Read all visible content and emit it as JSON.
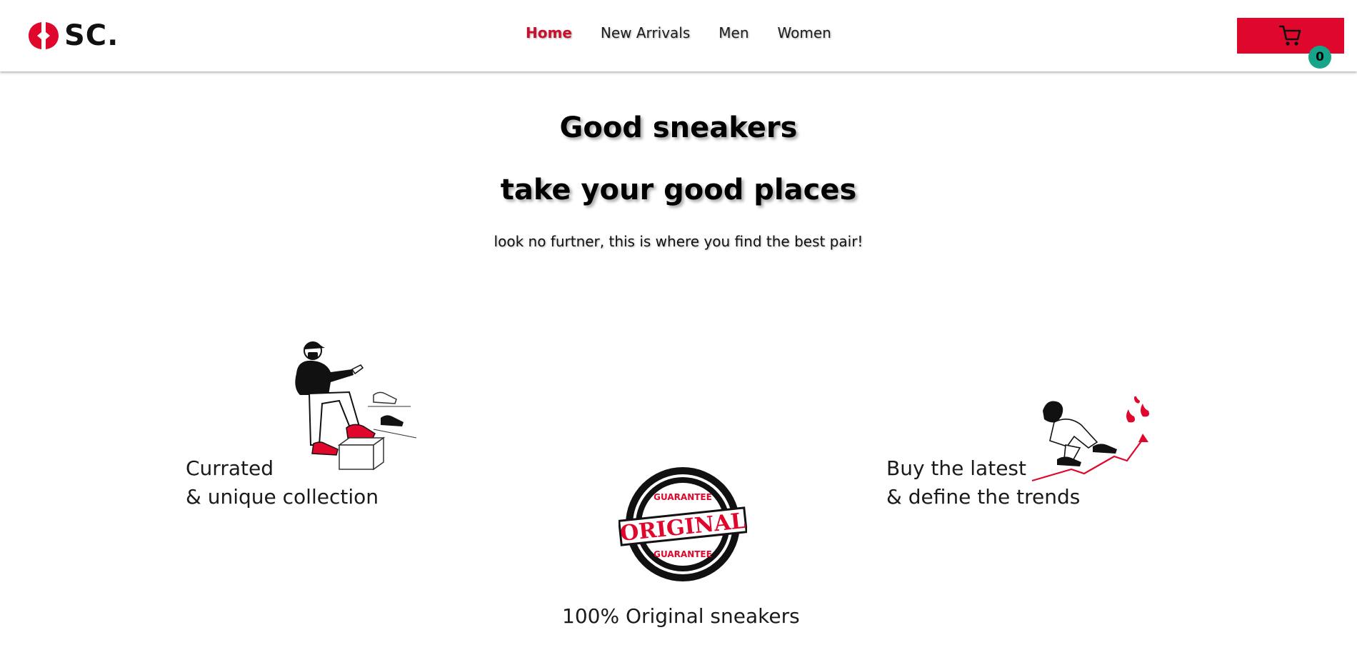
{
  "header": {
    "logo_text": "SC.",
    "nav": [
      {
        "label": "Home",
        "active": true
      },
      {
        "label": "New Arrivals",
        "active": false
      },
      {
        "label": "Men",
        "active": false
      },
      {
        "label": "Women",
        "active": false
      }
    ],
    "cart": {
      "icon": "cart-icon",
      "count": "0"
    }
  },
  "hero": {
    "title_line1": "Good sneakers",
    "title_line2": "take your good places",
    "subtitle": "look no furtner, this is where you find the best pair!"
  },
  "features": [
    {
      "line1": "Currated",
      "line2": "& unique collection",
      "illustration": "man-with-sneakers-illustration"
    },
    {
      "line1": "100% Original sneakers",
      "illustration": "original-guarantee-seal",
      "seal_top": "GUARANTEE",
      "seal_middle": "ORIGINAL",
      "seal_bottom": "GUARANTEE"
    },
    {
      "line1": "Buy the latest",
      "line2": "& define the trends",
      "illustration": "woman-trending-illustration"
    }
  ],
  "colors": {
    "brand_red": "#e0072c",
    "nav_active": "#c8102e",
    "badge_teal": "#17a589"
  }
}
